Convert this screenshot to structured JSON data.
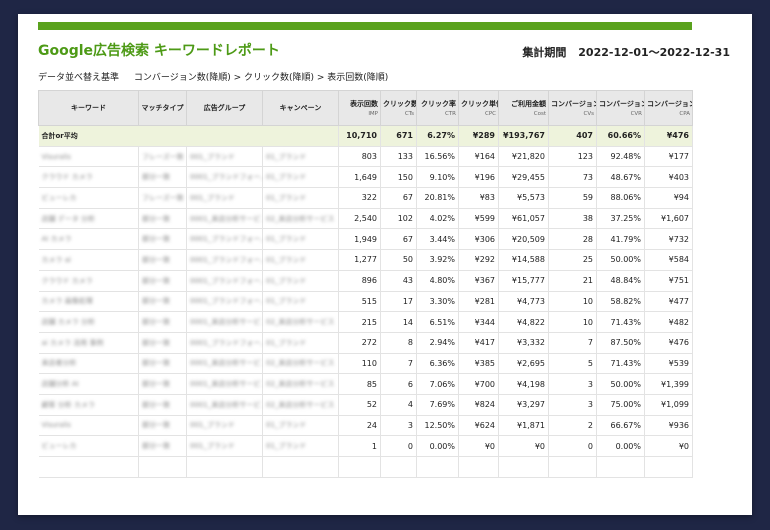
{
  "report": {
    "title": "Google広告検索 キーワードレポート",
    "period_label": "集計期間",
    "period_value": "2022-12-01～2022-12-31",
    "sort_label": "データ並べ替え基準",
    "sort_value": "コンバージョン数(降順) > クリック数(降順) > 表示回数(降順)"
  },
  "columns": [
    {
      "label": "キーワード",
      "sub": ""
    },
    {
      "label": "マッチタイプ",
      "sub": ""
    },
    {
      "label": "広告グループ",
      "sub": ""
    },
    {
      "label": "キャンペーン",
      "sub": ""
    },
    {
      "label": "表示回数",
      "sub": "IMP"
    },
    {
      "label": "クリック数",
      "sub": "CTs"
    },
    {
      "label": "クリック率",
      "sub": "CTR"
    },
    {
      "label": "クリック単価",
      "sub": "CPC"
    },
    {
      "label": "ご利用金額",
      "sub": "Cost"
    },
    {
      "label": "コンバージョン数",
      "sub": "CVs"
    },
    {
      "label": "コンバージョン率",
      "sub": "CVR"
    },
    {
      "label": "コンバージョン単価",
      "sub": "CPA"
    }
  ],
  "total": {
    "label": "合計or平均",
    "values": [
      "10,710",
      "671",
      "6.27%",
      "¥289",
      "¥193,767",
      "407",
      "60.66%",
      "¥476"
    ]
  },
  "rows": [
    {
      "text": [
        "Visuralis",
        "フレーズ一致",
        "001_ブランド",
        "01_ブランド"
      ],
      "values": [
        "803",
        "133",
        "16.56%",
        "¥164",
        "¥21,820",
        "123",
        "92.48%",
        "¥177"
      ]
    },
    {
      "text": [
        "クラウド カメラ",
        "部分一致",
        "0001_ブランドフォーム",
        "01_ブランド"
      ],
      "values": [
        "1,649",
        "150",
        "9.10%",
        "¥196",
        "¥29,455",
        "73",
        "48.67%",
        "¥403"
      ]
    },
    {
      "text": [
        "ビューレカ",
        "フレーズ一致",
        "001_ブランド",
        "01_ブランド"
      ],
      "values": [
        "322",
        "67",
        "20.81%",
        "¥83",
        "¥5,573",
        "59",
        "88.06%",
        "¥94"
      ]
    },
    {
      "text": [
        "店舗 データ 分析",
        "部分一致",
        "0001_来店分析サービス",
        "02_来店分析サービス"
      ],
      "values": [
        "2,540",
        "102",
        "4.02%",
        "¥599",
        "¥61,057",
        "38",
        "37.25%",
        "¥1,607"
      ]
    },
    {
      "text": [
        "AI カメラ",
        "部分一致",
        "0001_ブランドフォーム",
        "01_ブランド"
      ],
      "values": [
        "1,949",
        "67",
        "3.44%",
        "¥306",
        "¥20,509",
        "28",
        "41.79%",
        "¥732"
      ]
    },
    {
      "text": [
        "カメラ ai",
        "部分一致",
        "0001_ブランドフォーム",
        "01_ブランド"
      ],
      "values": [
        "1,277",
        "50",
        "3.92%",
        "¥292",
        "¥14,588",
        "25",
        "50.00%",
        "¥584"
      ]
    },
    {
      "text": [
        "クラウド カメラ",
        "部分一致",
        "0001_ブランドフォーム",
        "01_ブランド"
      ],
      "values": [
        "896",
        "43",
        "4.80%",
        "¥367",
        "¥15,777",
        "21",
        "48.84%",
        "¥751"
      ]
    },
    {
      "text": [
        "カメラ 画像処理",
        "部分一致",
        "0001_ブランドフォーム",
        "01_ブランド"
      ],
      "values": [
        "515",
        "17",
        "3.30%",
        "¥281",
        "¥4,773",
        "10",
        "58.82%",
        "¥477"
      ]
    },
    {
      "text": [
        "店舗 カメラ 分析",
        "部分一致",
        "0001_来店分析サービス",
        "02_来店分析サービス"
      ],
      "values": [
        "215",
        "14",
        "6.51%",
        "¥344",
        "¥4,822",
        "10",
        "71.43%",
        "¥482"
      ]
    },
    {
      "text": [
        "ai カメラ 活用 事例",
        "部分一致",
        "0001_ブランドフォーム",
        "01_ブランド"
      ],
      "values": [
        "272",
        "8",
        "2.94%",
        "¥417",
        "¥3,332",
        "7",
        "87.50%",
        "¥476"
      ]
    },
    {
      "text": [
        "来店者分析",
        "部分一致",
        "0001_来店分析サービス",
        "02_来店分析サービス"
      ],
      "values": [
        "110",
        "7",
        "6.36%",
        "¥385",
        "¥2,695",
        "5",
        "71.43%",
        "¥539"
      ]
    },
    {
      "text": [
        "店舗分析 AI",
        "部分一致",
        "0001_来店分析サービス",
        "02_来店分析サービス"
      ],
      "values": [
        "85",
        "6",
        "7.06%",
        "¥700",
        "¥4,198",
        "3",
        "50.00%",
        "¥1,399"
      ]
    },
    {
      "text": [
        "顧客 分析 カメラ",
        "部分一致",
        "0001_来店分析サービス",
        "02_来店分析サービス"
      ],
      "values": [
        "52",
        "4",
        "7.69%",
        "¥824",
        "¥3,297",
        "3",
        "75.00%",
        "¥1,099"
      ]
    },
    {
      "text": [
        "Visuralis",
        "部分一致",
        "001_ブランド",
        "01_ブランド"
      ],
      "values": [
        "24",
        "3",
        "12.50%",
        "¥624",
        "¥1,871",
        "2",
        "66.67%",
        "¥936"
      ]
    },
    {
      "text": [
        "ビューレカ",
        "部分一致",
        "001_ブランド",
        "01_ブランド"
      ],
      "values": [
        "1",
        "0",
        "0.00%",
        "¥0",
        "¥0",
        "0",
        "0.00%",
        "¥0"
      ]
    },
    {
      "text": [
        "",
        "",
        "",
        ""
      ],
      "values": [
        "",
        "",
        "",
        "",
        "",
        "",
        "",
        ""
      ]
    }
  ],
  "colors": {
    "accent": "#5aa21d",
    "title": "#4d9a16",
    "total_row": "#eef3dc",
    "header": "#e8e8e8",
    "frame": "#1f2645"
  }
}
